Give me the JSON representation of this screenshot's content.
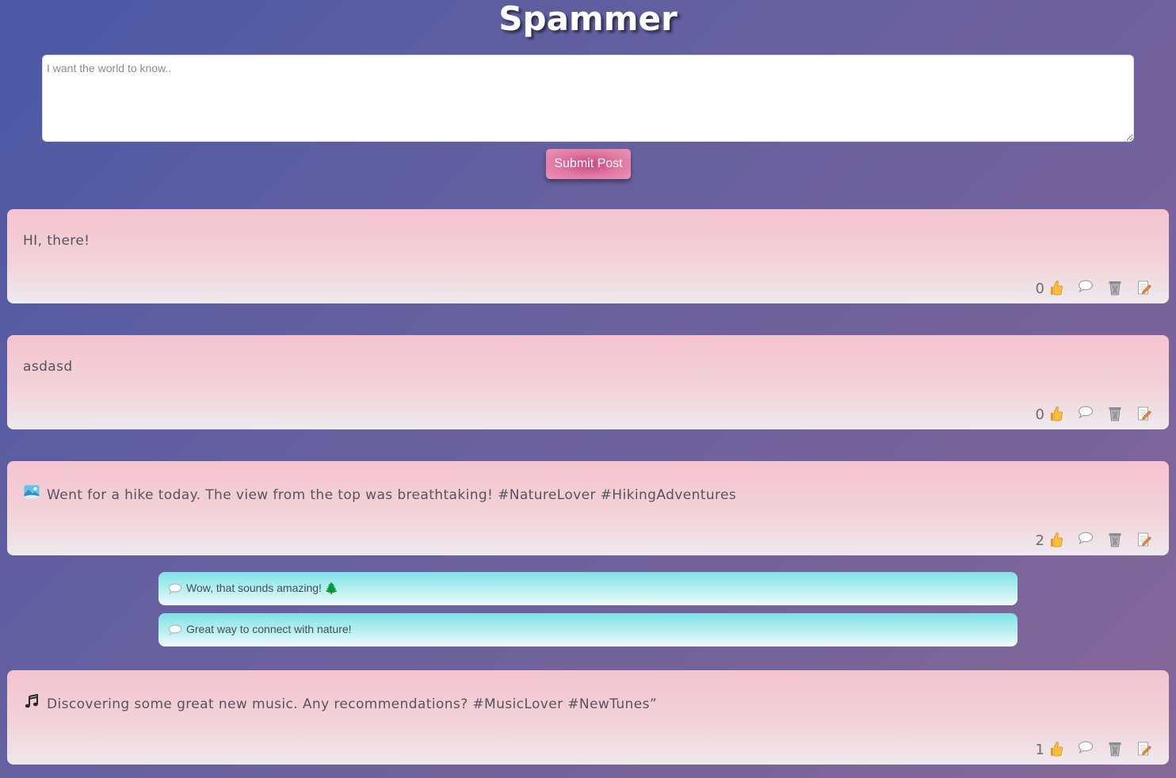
{
  "app": {
    "title": "Spammer"
  },
  "composer": {
    "placeholder": "I want the world to know..",
    "value": "",
    "submit_label": "Submit Post"
  },
  "posts": [
    {
      "emoji": "",
      "text": "HI, there!",
      "likes": "0"
    },
    {
      "emoji": "",
      "text": "asdasd",
      "likes": "0"
    },
    {
      "emoji": "🏞",
      "text": "Went for a hike today. The view from the top was breathtaking! #NatureLover #HikingAdventures",
      "likes": "2"
    },
    {
      "emoji": "🎵",
      "text": "Discovering some great new music. Any recommendations? #MusicLover #NewTunes”",
      "likes": "1"
    }
  ],
  "comments": [
    {
      "text": "Wow, that sounds amazing! 🌲"
    },
    {
      "text": "Great way to connect with nature!"
    }
  ],
  "icons": {
    "like": "thumbs-up-icon",
    "comment": "speech-bubble-icon",
    "delete": "trash-can-icon",
    "edit": "memo-pencil-icon"
  },
  "colors": {
    "post_top": "#f4c4cf",
    "post_bottom": "#eeeaee",
    "comment_top": "#7fe2e6",
    "comment_bottom": "#f1fbfc",
    "submit": "#e07aa3",
    "like_icon": "#f5b93c"
  }
}
